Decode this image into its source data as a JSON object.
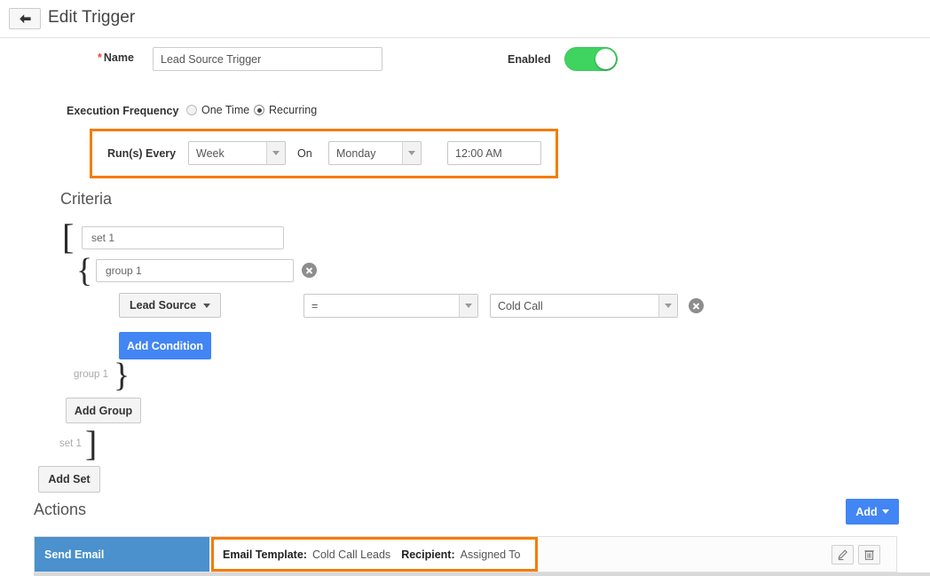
{
  "header": {
    "back_icon": "back-arrow-icon",
    "title": "Edit Trigger"
  },
  "form": {
    "name_label": "Name",
    "required_marker": "*",
    "name_value": "Lead Source Trigger",
    "name_placeholder": "Name",
    "enabled_label": "Enabled",
    "enabled_state": "on"
  },
  "execution": {
    "label": "Execution Frequency",
    "options": [
      {
        "label": "One Time",
        "selected": false
      },
      {
        "label": "Recurring",
        "selected": true
      }
    ],
    "recurrence": {
      "runs_every_label": "Run(s) Every",
      "interval_value": "Week",
      "on_label": "On",
      "day_value": "Monday",
      "time_value": "12:00 AM",
      "highlight_color": "#f57c00"
    }
  },
  "criteria": {
    "title": "Criteria",
    "open_bracket": "[",
    "close_bracket": "]",
    "open_brace": "{",
    "close_brace": "}",
    "set_name": "set 1",
    "set_placeholder": "set 1",
    "group_name": "group 1",
    "group_placeholder": "group 1",
    "group_ghost_label": "group 1",
    "set_ghost_label": "set 1",
    "condition": {
      "field": "Lead Source",
      "operator": "=",
      "value": "Cold Call",
      "remove_icon": "remove-circle-icon"
    },
    "remove_group_icon": "remove-circle-icon",
    "add_condition_label": "Add Condition",
    "add_group_label": "Add Group",
    "add_set_label": "Add Set",
    "accent_blue": "#4285f4"
  },
  "actions": {
    "title": "Actions",
    "add_label": "Add",
    "add_caret_icon": "chevron-down-icon",
    "rows": [
      {
        "type": "Send Email",
        "details": [
          {
            "key": "Email Template:",
            "value": "Cold Call Leads"
          },
          {
            "key": "Recipient:",
            "value": "Assigned To"
          }
        ],
        "edit_icon": "pencil-icon",
        "delete_icon": "trash-icon",
        "type_color": "#4a91cd",
        "highlight_color": "#f57c00"
      }
    ]
  }
}
